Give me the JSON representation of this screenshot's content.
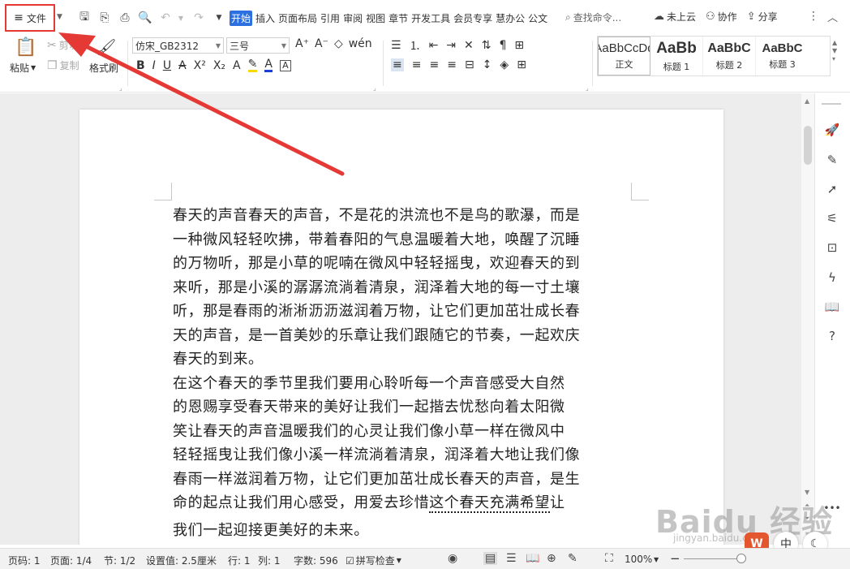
{
  "topbar": {
    "file_label": "文件",
    "tabs": [
      "开始",
      "插入",
      "页面布局",
      "引用",
      "审阅",
      "视图",
      "章节",
      "开发工具",
      "会员专享",
      "慧办公",
      "公文"
    ],
    "search_placeholder": "查找命令...",
    "cloud_label": "未上云",
    "collab_label": "协作",
    "share_label": "分享"
  },
  "ribbon": {
    "paste": "粘贴",
    "cut": "剪切",
    "copy": "复制",
    "format_painter": "格式刷",
    "font_name": "仿宋_GB2312",
    "font_size": "三号",
    "styles": [
      {
        "preview": "AaBbCcDd",
        "name": "正文"
      },
      {
        "preview": "AaBb",
        "name": "标题 1"
      },
      {
        "preview": "AaBbC",
        "name": "标题 2"
      },
      {
        "preview": "AaBbC",
        "name": "标题 3"
      }
    ]
  },
  "document": {
    "paragraph1_lines": [
      "春天的声音春天的声音，不是花的洪流也不是鸟的歌瀑，而是",
      "一种微风轻轻吹拂，带着春阳的气息温暖着大地，唤醒了沉睡",
      "的万物听，那是小草的呢喃在微风中轻轻摇曳，欢迎春天的到",
      "来听，那是小溪的潺潺流淌着清泉，润泽着大地的每一寸土壤",
      "听，那是春雨的淅淅沥沥滋润着万物，让它们更加茁壮成长春",
      "天的声音，是一首美妙的乐章让我们跟随它的节奏，一起欢庆",
      "春天的到来。"
    ],
    "paragraph2_lines": [
      "在这个春天的季节里我们要用心聆听每一个声音感受大自然",
      "的恩赐享受春天带来的美好让我们一起揩去忧愁向着太阳微",
      "笑让春天的声音温暖我们的心灵让我们像小草一样在微风中",
      "轻轻摇曳让我们像小溪一样流淌着清泉，润泽着大地让我们像",
      "春雨一样滋润着万物，让它们更加茁壮成长春天的声音，是生"
    ],
    "line_pre": "命的起点让我们用心感受，用爱去珍惜",
    "line_dotted": "这个春天充满希望",
    "line_post": "让",
    "last_line": "我们一起迎接更美好的未来。"
  },
  "watermark": {
    "big": "Baidu 经验",
    "small": "jingyan.baidu.com"
  },
  "statusbar": {
    "page_num": "页码: 1",
    "pages": "页面: 1/4",
    "section": "节: 1/2",
    "setting": "设置值: 2.5厘米",
    "row": "行: 1",
    "col": "列: 1",
    "word_count": "字数: 596",
    "spell_check": "拼写检查",
    "zoom": "100%"
  },
  "colors": {
    "accent": "#2b6fe0",
    "highlight": "#e53935",
    "wps_logo": "#e4572e"
  }
}
